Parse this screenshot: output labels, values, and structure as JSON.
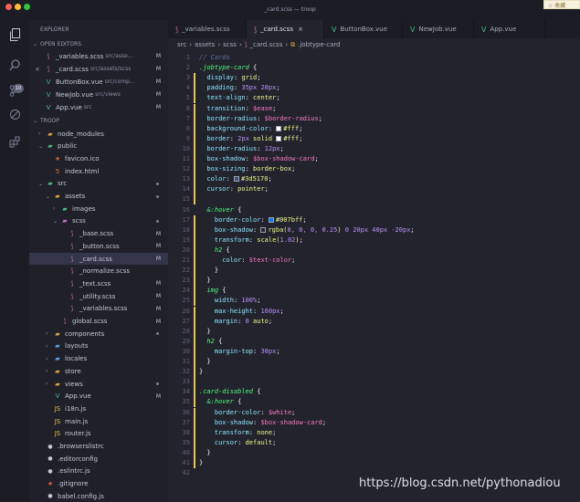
{
  "window": {
    "title": "_card.scss — troop",
    "badge": "☆ 收藏"
  },
  "colors": {
    "vue": "#49bf82",
    "sass": "#d36b9c",
    "js": "#e8c54d",
    "modified_bar": "#e8c54d"
  },
  "activity_bar": {
    "icons": [
      "files-icon",
      "search-icon",
      "source-control-icon",
      "debug-icon",
      "extensions-icon"
    ],
    "badge": "10"
  },
  "sidebar": {
    "title": "EXPLORER",
    "open_editors_label": "OPEN EDITORS",
    "open_editors": [
      {
        "name": "_variables.scss",
        "path": "src/asse...",
        "mark": "M",
        "icon": "sass"
      },
      {
        "name": "_card.scss",
        "path": "src/assets/scss",
        "mark": "M",
        "icon": "sass"
      },
      {
        "name": "ButtonBox.vue",
        "path": "src/comp...",
        "mark": "M",
        "icon": "vue"
      },
      {
        "name": "NewJob.vue",
        "path": "src/views",
        "mark": "M",
        "icon": "vue"
      },
      {
        "name": "App.vue",
        "path": "src",
        "mark": "M",
        "icon": "vue"
      }
    ],
    "project_label": "TROOP",
    "tree": [
      {
        "name": "node_modules",
        "depth": 1,
        "arrow": "›",
        "icon": "fold"
      },
      {
        "name": "public",
        "depth": 1,
        "arrow": "⌄",
        "icon": "foldg"
      },
      {
        "name": "favicon.ico",
        "depth": 2,
        "arrow": "",
        "icon": "ico"
      },
      {
        "name": "index.html",
        "depth": 2,
        "arrow": "",
        "icon": "html"
      },
      {
        "name": "src",
        "depth": 1,
        "arrow": "⌄",
        "icon": "foldg",
        "dot": true
      },
      {
        "name": "assets",
        "depth": 2,
        "arrow": "⌄",
        "icon": "fold",
        "dot": true
      },
      {
        "name": "images",
        "depth": 3,
        "arrow": "›",
        "icon": "foldg"
      },
      {
        "name": "scss",
        "depth": 3,
        "arrow": "⌄",
        "icon": "foldp",
        "dot": true
      },
      {
        "name": "_base.scss",
        "depth": 4,
        "arrow": "",
        "icon": "sass",
        "mark": "M"
      },
      {
        "name": "_button.scss",
        "depth": 4,
        "arrow": "",
        "icon": "sass",
        "mark": "M"
      },
      {
        "name": "_card.scss",
        "depth": 4,
        "arrow": "",
        "icon": "sass",
        "mark": "M",
        "selected": true
      },
      {
        "name": "_normalize.scss",
        "depth": 4,
        "arrow": "",
        "icon": "sass"
      },
      {
        "name": "_text.scss",
        "depth": 4,
        "arrow": "",
        "icon": "sass",
        "mark": "M"
      },
      {
        "name": "_utility.scss",
        "depth": 4,
        "arrow": "",
        "icon": "sass",
        "mark": "M"
      },
      {
        "name": "_variables.scss",
        "depth": 4,
        "arrow": "",
        "icon": "sass",
        "mark": "M"
      },
      {
        "name": "global.scss",
        "depth": 3,
        "arrow": "",
        "icon": "sass",
        "mark": "M"
      },
      {
        "name": "components",
        "depth": 2,
        "arrow": "›",
        "icon": "fold",
        "dot": true
      },
      {
        "name": "layouts",
        "depth": 2,
        "arrow": "›",
        "icon": "foldb"
      },
      {
        "name": "locales",
        "depth": 2,
        "arrow": "›",
        "icon": "foldb"
      },
      {
        "name": "store",
        "depth": 2,
        "arrow": "›",
        "icon": "fold"
      },
      {
        "name": "views",
        "depth": 2,
        "arrow": "›",
        "icon": "fold",
        "dot": true
      },
      {
        "name": "App.vue",
        "depth": 2,
        "arrow": "",
        "icon": "vue",
        "mark": "M"
      },
      {
        "name": "i18n.js",
        "depth": 2,
        "arrow": "",
        "icon": "js"
      },
      {
        "name": "main.js",
        "depth": 2,
        "arrow": "",
        "icon": "js"
      },
      {
        "name": "router.js",
        "depth": 2,
        "arrow": "",
        "icon": "js"
      },
      {
        "name": ".browserslistrc",
        "depth": 1,
        "arrow": "",
        "icon": "misc"
      },
      {
        "name": ".editorconfig",
        "depth": 1,
        "arrow": "",
        "icon": "misc"
      },
      {
        "name": ".eslintrc.js",
        "depth": 1,
        "arrow": "",
        "icon": "misc"
      },
      {
        "name": ".gitignore",
        "depth": 1,
        "arrow": "",
        "icon": "ico"
      },
      {
        "name": "babel.config.js",
        "depth": 1,
        "arrow": "",
        "icon": "misc"
      }
    ]
  },
  "tabs": [
    {
      "label": "_variables.scss",
      "icon": "sass"
    },
    {
      "label": "_card.scss",
      "icon": "sass",
      "active": true
    },
    {
      "label": "ButtonBox.vue",
      "icon": "vue"
    },
    {
      "label": "NewJob.vue",
      "icon": "vue"
    },
    {
      "label": "App.vue",
      "icon": "vue"
    }
  ],
  "breadcrumb": [
    "src",
    "assets",
    "scss",
    "_card.scss",
    ".jobtype-card"
  ],
  "code": [
    [
      [
        "c",
        "// Cards"
      ]
    ],
    [
      [
        "s",
        ".jobtype-card"
      ],
      [
        "b",
        " {"
      ]
    ],
    [
      [
        "p",
        "  display"
      ],
      [
        "b",
        ": "
      ],
      [
        "v",
        "grid"
      ],
      [
        "b",
        ";"
      ]
    ],
    [
      [
        "p",
        "  padding"
      ],
      [
        "b",
        ": "
      ],
      [
        "n",
        "35px 20px"
      ],
      [
        "b",
        ";"
      ]
    ],
    [
      [
        "p",
        "  text-align"
      ],
      [
        "b",
        ": "
      ],
      [
        "v",
        "center"
      ],
      [
        "b",
        ";"
      ]
    ],
    [
      [
        "p",
        "  transition"
      ],
      [
        "b",
        ": "
      ],
      [
        "x",
        "$ease"
      ],
      [
        "b",
        ";"
      ]
    ],
    [
      [
        "p",
        "  border-radius"
      ],
      [
        "b",
        ": "
      ],
      [
        "x",
        "$border-radius"
      ],
      [
        "b",
        ";"
      ]
    ],
    [
      [
        "p",
        "  background-color"
      ],
      [
        "b",
        ": "
      ],
      [
        "w",
        "#ffffff"
      ],
      [
        "v",
        "#fff"
      ],
      [
        "b",
        ";"
      ]
    ],
    [
      [
        "p",
        "  border"
      ],
      [
        "b",
        ": "
      ],
      [
        "n",
        "2px"
      ],
      [
        "v",
        " solid "
      ],
      [
        "w",
        "#ffffff"
      ],
      [
        "v",
        "#fff"
      ],
      [
        "b",
        ";"
      ]
    ],
    [
      [
        "p",
        "  border-radius"
      ],
      [
        "b",
        ": "
      ],
      [
        "n",
        "12px"
      ],
      [
        "b",
        ";"
      ]
    ],
    [
      [
        "p",
        "  box-shadow"
      ],
      [
        "b",
        ": "
      ],
      [
        "x",
        "$box-shadow-card"
      ],
      [
        "b",
        ";"
      ]
    ],
    [
      [
        "p",
        "  box-sizing"
      ],
      [
        "b",
        ": "
      ],
      [
        "v",
        "border-box"
      ],
      [
        "b",
        ";"
      ]
    ],
    [
      [
        "p",
        "  color"
      ],
      [
        "b",
        ": "
      ],
      [
        "w",
        "#3d5170"
      ],
      [
        "v",
        "#3d5170"
      ],
      [
        "b",
        ";"
      ]
    ],
    [
      [
        "p",
        "  cursor"
      ],
      [
        "b",
        ": "
      ],
      [
        "v",
        "pointer"
      ],
      [
        "b",
        ";"
      ]
    ],
    [],
    [
      [
        "b",
        "  "
      ],
      [
        "s",
        "&:hover"
      ],
      [
        "b",
        " {"
      ]
    ],
    [
      [
        "p",
        "    border-color"
      ],
      [
        "b",
        ": "
      ],
      [
        "w",
        "#007bff"
      ],
      [
        "v",
        "#007bff"
      ],
      [
        "b",
        ";"
      ]
    ],
    [
      [
        "p",
        "    box-shadow"
      ],
      [
        "b",
        ": "
      ],
      [
        "w",
        "#21222c"
      ],
      [
        "v",
        "rgba("
      ],
      [
        "n",
        "0, 0, 0, 0.25"
      ],
      [
        "v",
        ") "
      ],
      [
        "n",
        "0 20px 40px -20px"
      ],
      [
        "b",
        ";"
      ]
    ],
    [
      [
        "p",
        "    transform"
      ],
      [
        "b",
        ": "
      ],
      [
        "v",
        "scale("
      ],
      [
        "n",
        "1.02"
      ],
      [
        "v",
        ")"
      ],
      [
        "b",
        ";"
      ]
    ],
    [
      [
        "s",
        "    h2"
      ],
      [
        "b",
        " {"
      ]
    ],
    [
      [
        "p",
        "      color"
      ],
      [
        "b",
        ": "
      ],
      [
        "x",
        "$text-color"
      ],
      [
        "b",
        ";"
      ]
    ],
    [
      [
        "b",
        "    }"
      ]
    ],
    [
      [
        "b",
        "  }"
      ]
    ],
    [
      [
        "s",
        "  img"
      ],
      [
        "b",
        " {"
      ]
    ],
    [
      [
        "p",
        "    width"
      ],
      [
        "b",
        ": "
      ],
      [
        "n",
        "100%"
      ],
      [
        "b",
        ";"
      ]
    ],
    [
      [
        "p",
        "    max-height"
      ],
      [
        "b",
        ": "
      ],
      [
        "n",
        "160px"
      ],
      [
        "b",
        ";"
      ]
    ],
    [
      [
        "p",
        "    margin"
      ],
      [
        "b",
        ": "
      ],
      [
        "n",
        "0"
      ],
      [
        "v",
        " auto"
      ],
      [
        "b",
        ";"
      ]
    ],
    [
      [
        "b",
        "  }"
      ]
    ],
    [
      [
        "s",
        "  h2"
      ],
      [
        "b",
        " {"
      ]
    ],
    [
      [
        "p",
        "    margin-top"
      ],
      [
        "b",
        ": "
      ],
      [
        "n",
        "30px"
      ],
      [
        "b",
        ";"
      ]
    ],
    [
      [
        "b",
        "  }"
      ]
    ],
    [
      [
        "b",
        "}"
      ]
    ],
    [],
    [
      [
        "s",
        ".card-disabled"
      ],
      [
        "b",
        " {"
      ]
    ],
    [
      [
        "b",
        "  "
      ],
      [
        "s",
        "&:hover"
      ],
      [
        "b",
        " {"
      ]
    ],
    [
      [
        "p",
        "    border-color"
      ],
      [
        "b",
        ": "
      ],
      [
        "x",
        "$white"
      ],
      [
        "b",
        ";"
      ]
    ],
    [
      [
        "p",
        "    box-shadow"
      ],
      [
        "b",
        ": "
      ],
      [
        "x",
        "$box-shadow-card"
      ],
      [
        "b",
        ";"
      ]
    ],
    [
      [
        "p",
        "    transform"
      ],
      [
        "b",
        ": "
      ],
      [
        "v",
        "none"
      ],
      [
        "b",
        ";"
      ]
    ],
    [
      [
        "p",
        "    cursor"
      ],
      [
        "b",
        ": "
      ],
      [
        "v",
        "default"
      ],
      [
        "b",
        ";"
      ]
    ],
    [
      [
        "b",
        "  }"
      ]
    ],
    [
      [
        "b",
        "}"
      ]
    ],
    []
  ],
  "modified_lines": [
    3,
    4,
    5,
    6,
    7,
    8,
    9,
    10,
    11,
    12,
    13,
    14,
    15,
    17,
    18,
    19,
    20,
    21,
    22,
    23,
    24,
    25,
    26,
    27,
    28,
    29,
    30,
    31,
    32,
    33,
    34,
    35,
    36,
    37,
    38,
    39,
    40,
    41
  ],
  "watermark": "https://blog.csdn.net/pythonadiou"
}
